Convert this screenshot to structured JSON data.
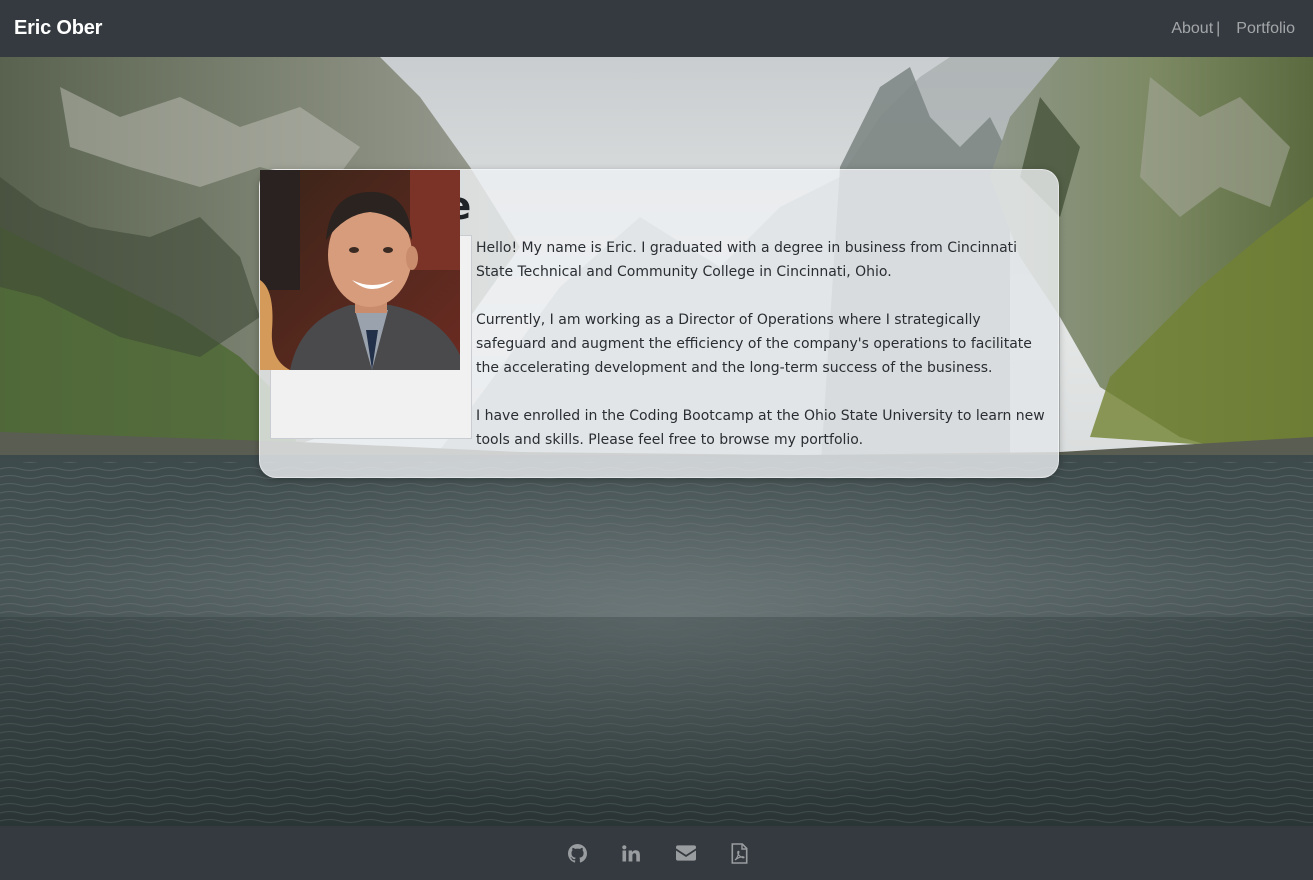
{
  "navbar": {
    "brand": "Eric Ober",
    "links": [
      {
        "label": "About"
      },
      {
        "label": "Portfolio"
      }
    ],
    "separator": "|"
  },
  "about": {
    "title": "About Me",
    "paragraphs": [
      "Hello! My name is Eric. I graduated with a degree in business from Cincinnati State Technical and Community College in Cincinnati, Ohio.",
      "Currently, I am working as a Director of Operations where I strategically safeguard and augment the efficiency of the company's operations to facilitate the accelerating development and the long-term success of the business.",
      "I have enrolled in the Coding Bootcamp at the Ohio State University to learn new tools and skills. Please feel free to browse my portfolio."
    ]
  },
  "footer": {
    "social": [
      {
        "icon": "github-icon"
      },
      {
        "icon": "linkedin-icon"
      },
      {
        "icon": "envelope-icon"
      },
      {
        "icon": "pdf-file-icon"
      }
    ]
  },
  "colors": {
    "navbar_bg": "#343a40",
    "nav_link": "#9a9da0",
    "brand": "#ffffff",
    "footer_icon": "#9a9da0",
    "card_bg": "#eef0f2"
  }
}
